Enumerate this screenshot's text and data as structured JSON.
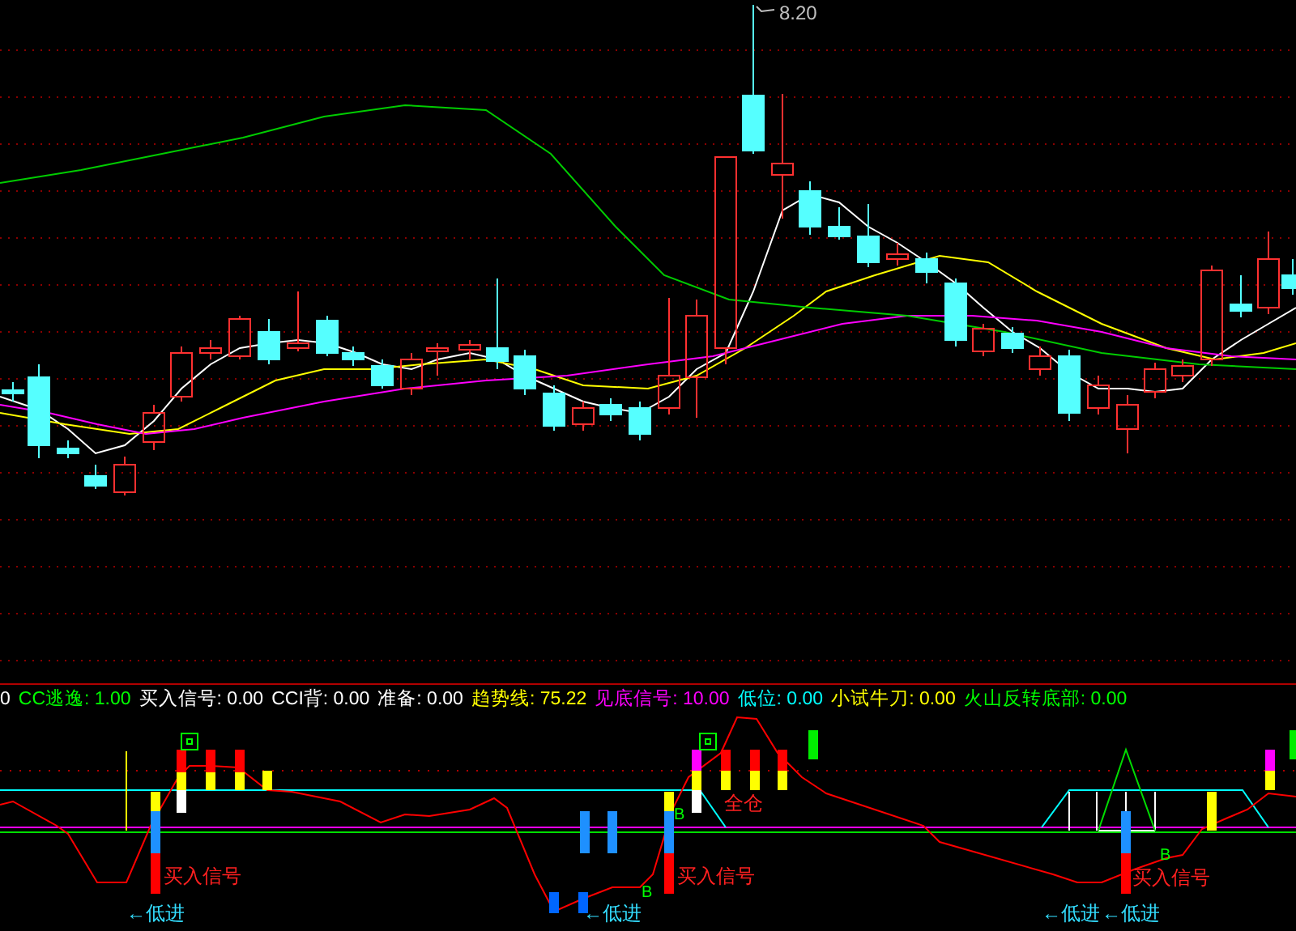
{
  "price_chart": {
    "high_label": "8.20"
  },
  "legend": [
    {
      "text": "0",
      "color": "#ffffff"
    },
    {
      "text": "CC逃逸: 1.00",
      "color": "#00ff00"
    },
    {
      "text": "买入信号: 0.00",
      "color": "#ffffff"
    },
    {
      "text": "CCI背: 0.00",
      "color": "#ffffff"
    },
    {
      "text": "准备: 0.00",
      "color": "#ffffff"
    },
    {
      "text": "趋势线: 75.22",
      "color": "#ffff00"
    },
    {
      "text": "见底信号: 10.00",
      "color": "#ff00ff"
    },
    {
      "text": "低位: 0.00",
      "color": "#00ffff"
    },
    {
      "text": "小试牛刀: 0.00",
      "color": "#ffff00"
    },
    {
      "text": "火山反转底部: 0.00",
      "color": "#00ff00"
    }
  ],
  "signal_chart": {
    "labels": [
      {
        "kind": "buy",
        "text": "买入信号"
      },
      {
        "kind": "buy",
        "text": "买入信号"
      },
      {
        "kind": "buy",
        "text": "买入信号"
      },
      {
        "kind": "low",
        "text": "←低进"
      },
      {
        "kind": "low",
        "text": "←低进"
      },
      {
        "kind": "low",
        "text": "←低进"
      },
      {
        "kind": "low",
        "text": "←低进"
      },
      {
        "kind": "full",
        "text": "全仓"
      },
      {
        "kind": "marker",
        "text": "B"
      },
      {
        "kind": "marker",
        "text": "B"
      },
      {
        "kind": "marker",
        "text": "B"
      }
    ]
  }
}
